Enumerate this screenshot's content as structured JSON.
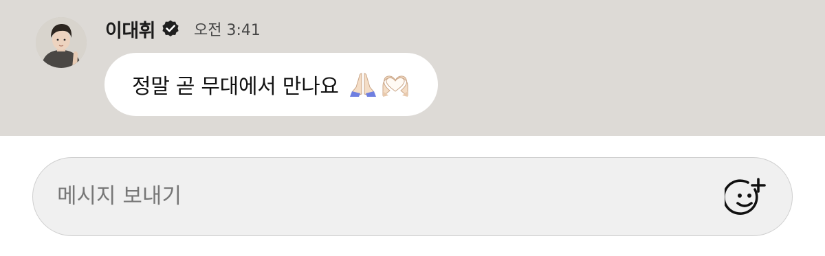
{
  "message": {
    "sender_name": "이대휘",
    "time": "오전 3:41",
    "text": "정말 곧 무대에서 만나요",
    "emojis": [
      "folded-hands-emoji",
      "heart-hands-emoji"
    ]
  },
  "composer": {
    "placeholder": "메시지 보내기",
    "emoji_button_icon": "add-emoji-icon"
  },
  "colors": {
    "chat_background": "#dddad6",
    "bubble": "#ffffff",
    "input_background": "#f0f0f0"
  }
}
